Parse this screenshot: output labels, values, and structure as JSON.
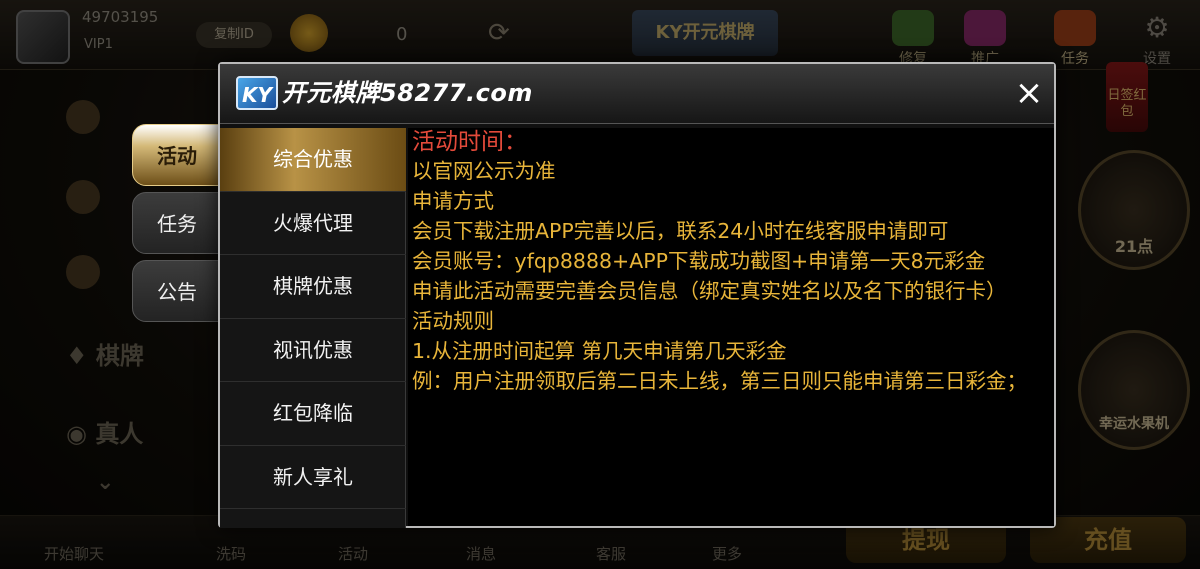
{
  "lobby": {
    "user_id": "49703195",
    "vip": "VIP1",
    "copy_id_label": "复制ID",
    "balance": "0",
    "top_logo": "KY开元棋牌",
    "top_icons": [
      "修复",
      "推广",
      "任务",
      "设置"
    ],
    "left_nav": [
      "棋牌",
      "真人"
    ],
    "bottom_bar": [
      "开始聊天",
      "洗码",
      "活动",
      "消息",
      "客服",
      "更多"
    ],
    "withdraw_button": "提现",
    "recharge_button": "充值",
    "sign_badge": "日签红包",
    "promo_labels": [
      "21点",
      "幸运水果机"
    ]
  },
  "side_tabs": [
    {
      "label": "活动",
      "active": true
    },
    {
      "label": "任务",
      "active": false
    },
    {
      "label": "公告",
      "active": false
    }
  ],
  "dialog": {
    "logo_ky": "KY",
    "logo_name": "开元棋牌58277.com",
    "close_icon": "×",
    "menu": [
      {
        "label": "综合优惠",
        "active": true
      },
      {
        "label": "火爆代理",
        "active": false
      },
      {
        "label": "棋牌优惠",
        "active": false
      },
      {
        "label": "视讯优惠",
        "active": false
      },
      {
        "label": "红包降临",
        "active": false
      },
      {
        "label": "新人享礼",
        "active": false
      }
    ],
    "content": {
      "heading": "活动时间：",
      "lines": [
        "以官网公示为准",
        "申请方式",
        "会员下载注册APP完善以后，联系24小时在线客服申请即可",
        "会员账号：yfqp8888+APP下载成功截图+申请第一天8元彩金",
        "申请此活动需要完善会员信息（绑定真实姓名以及名下的银行卡）",
        "活动规则",
        "1.从注册时间起算 第几天申请第几天彩金",
        "例：用户注册领取后第二日未上线，第三日则只能申请第三日彩金；"
      ]
    }
  }
}
